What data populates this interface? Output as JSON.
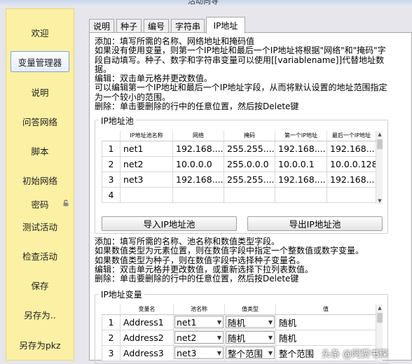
{
  "window": {
    "title": "活动向导"
  },
  "sidebar": {
    "items": [
      {
        "label": "欢迎"
      },
      {
        "label": "变量管理器"
      },
      {
        "label": "说明"
      },
      {
        "label": "问答网络"
      },
      {
        "label": "脚本"
      },
      {
        "label": "初始网络"
      },
      {
        "label": "密码"
      },
      {
        "label": "测试活动"
      },
      {
        "label": "检查活动"
      },
      {
        "label": "保存"
      },
      {
        "label": "另存为.."
      },
      {
        "label": "另存为pkz"
      }
    ]
  },
  "tabs": [
    {
      "label": "说明"
    },
    {
      "label": "种子"
    },
    {
      "label": "编号"
    },
    {
      "label": "字符串"
    },
    {
      "label": "IP地址"
    }
  ],
  "pool_help": "添加：填写所需的名称、网络地址和掩码值\n如果没有使用变量，则第一个IP地址和最后一个IP地址将根据\"网络\"和\"掩码\"字\n段自动填写。种子、数字和字符串变量可以使用[[variablename]]代替地址数\n据。\n编辑：双击单元格并更改数值。\n可以编辑第一个IP地址和最后一个IP地址字段，从而将默认设置的地址范围指定\n为一个较小的范围。\n删除：单击要删除的行中的任意位置，然后按Delete键",
  "pool": {
    "title": "IP地址池",
    "columns": [
      "",
      "IP地址池名称",
      "网络",
      "掩码",
      "第一个IP地址",
      "最后一个IP地址"
    ],
    "rows": [
      [
        "1",
        "net1",
        "192.168....",
        "255.255....",
        "192.168....",
        "192.168...."
      ],
      [
        "2",
        "net2",
        "10.0.0.0",
        "255.0.0.0",
        "10.0.0.1",
        "10.0.0.128"
      ],
      [
        "3",
        "net3",
        "192.168....",
        "255.255....",
        "192.168....",
        "192.168...."
      ],
      [
        "4",
        "",
        "",
        "",
        "",
        ""
      ]
    ],
    "import_label": "导入IP地址池",
    "export_label": "导出IP地址池"
  },
  "var_help": "添加：填写所需的名称、池名称和数值类型字段。\n如果数值类型为元素位置，则在数值字段中指定一个整数值或数字变量。\n如果数值类型为种子，则在数值字段中选择种子变量名。\n编辑：双击单元格并更改数值，或重新选择下拉列表数值。\n删除：单击要删除的行中的任意位置，然后按Delete键",
  "vars": {
    "title": "IP地址变量",
    "columns": [
      "",
      "变量名",
      "池名称",
      "值类型",
      "值"
    ],
    "rows": [
      {
        "n": "1",
        "name": "Address1",
        "pool": "net1",
        "type": "随机",
        "value": "随机"
      },
      {
        "n": "2",
        "name": "Address2",
        "pool": "net2",
        "type": "随机",
        "value": "随机"
      },
      {
        "n": "3",
        "name": "Address3",
        "pool": "net3",
        "type": "整个范围",
        "value": "整个范围"
      }
    ]
  },
  "watermark": "头条 @阿贾书琛"
}
